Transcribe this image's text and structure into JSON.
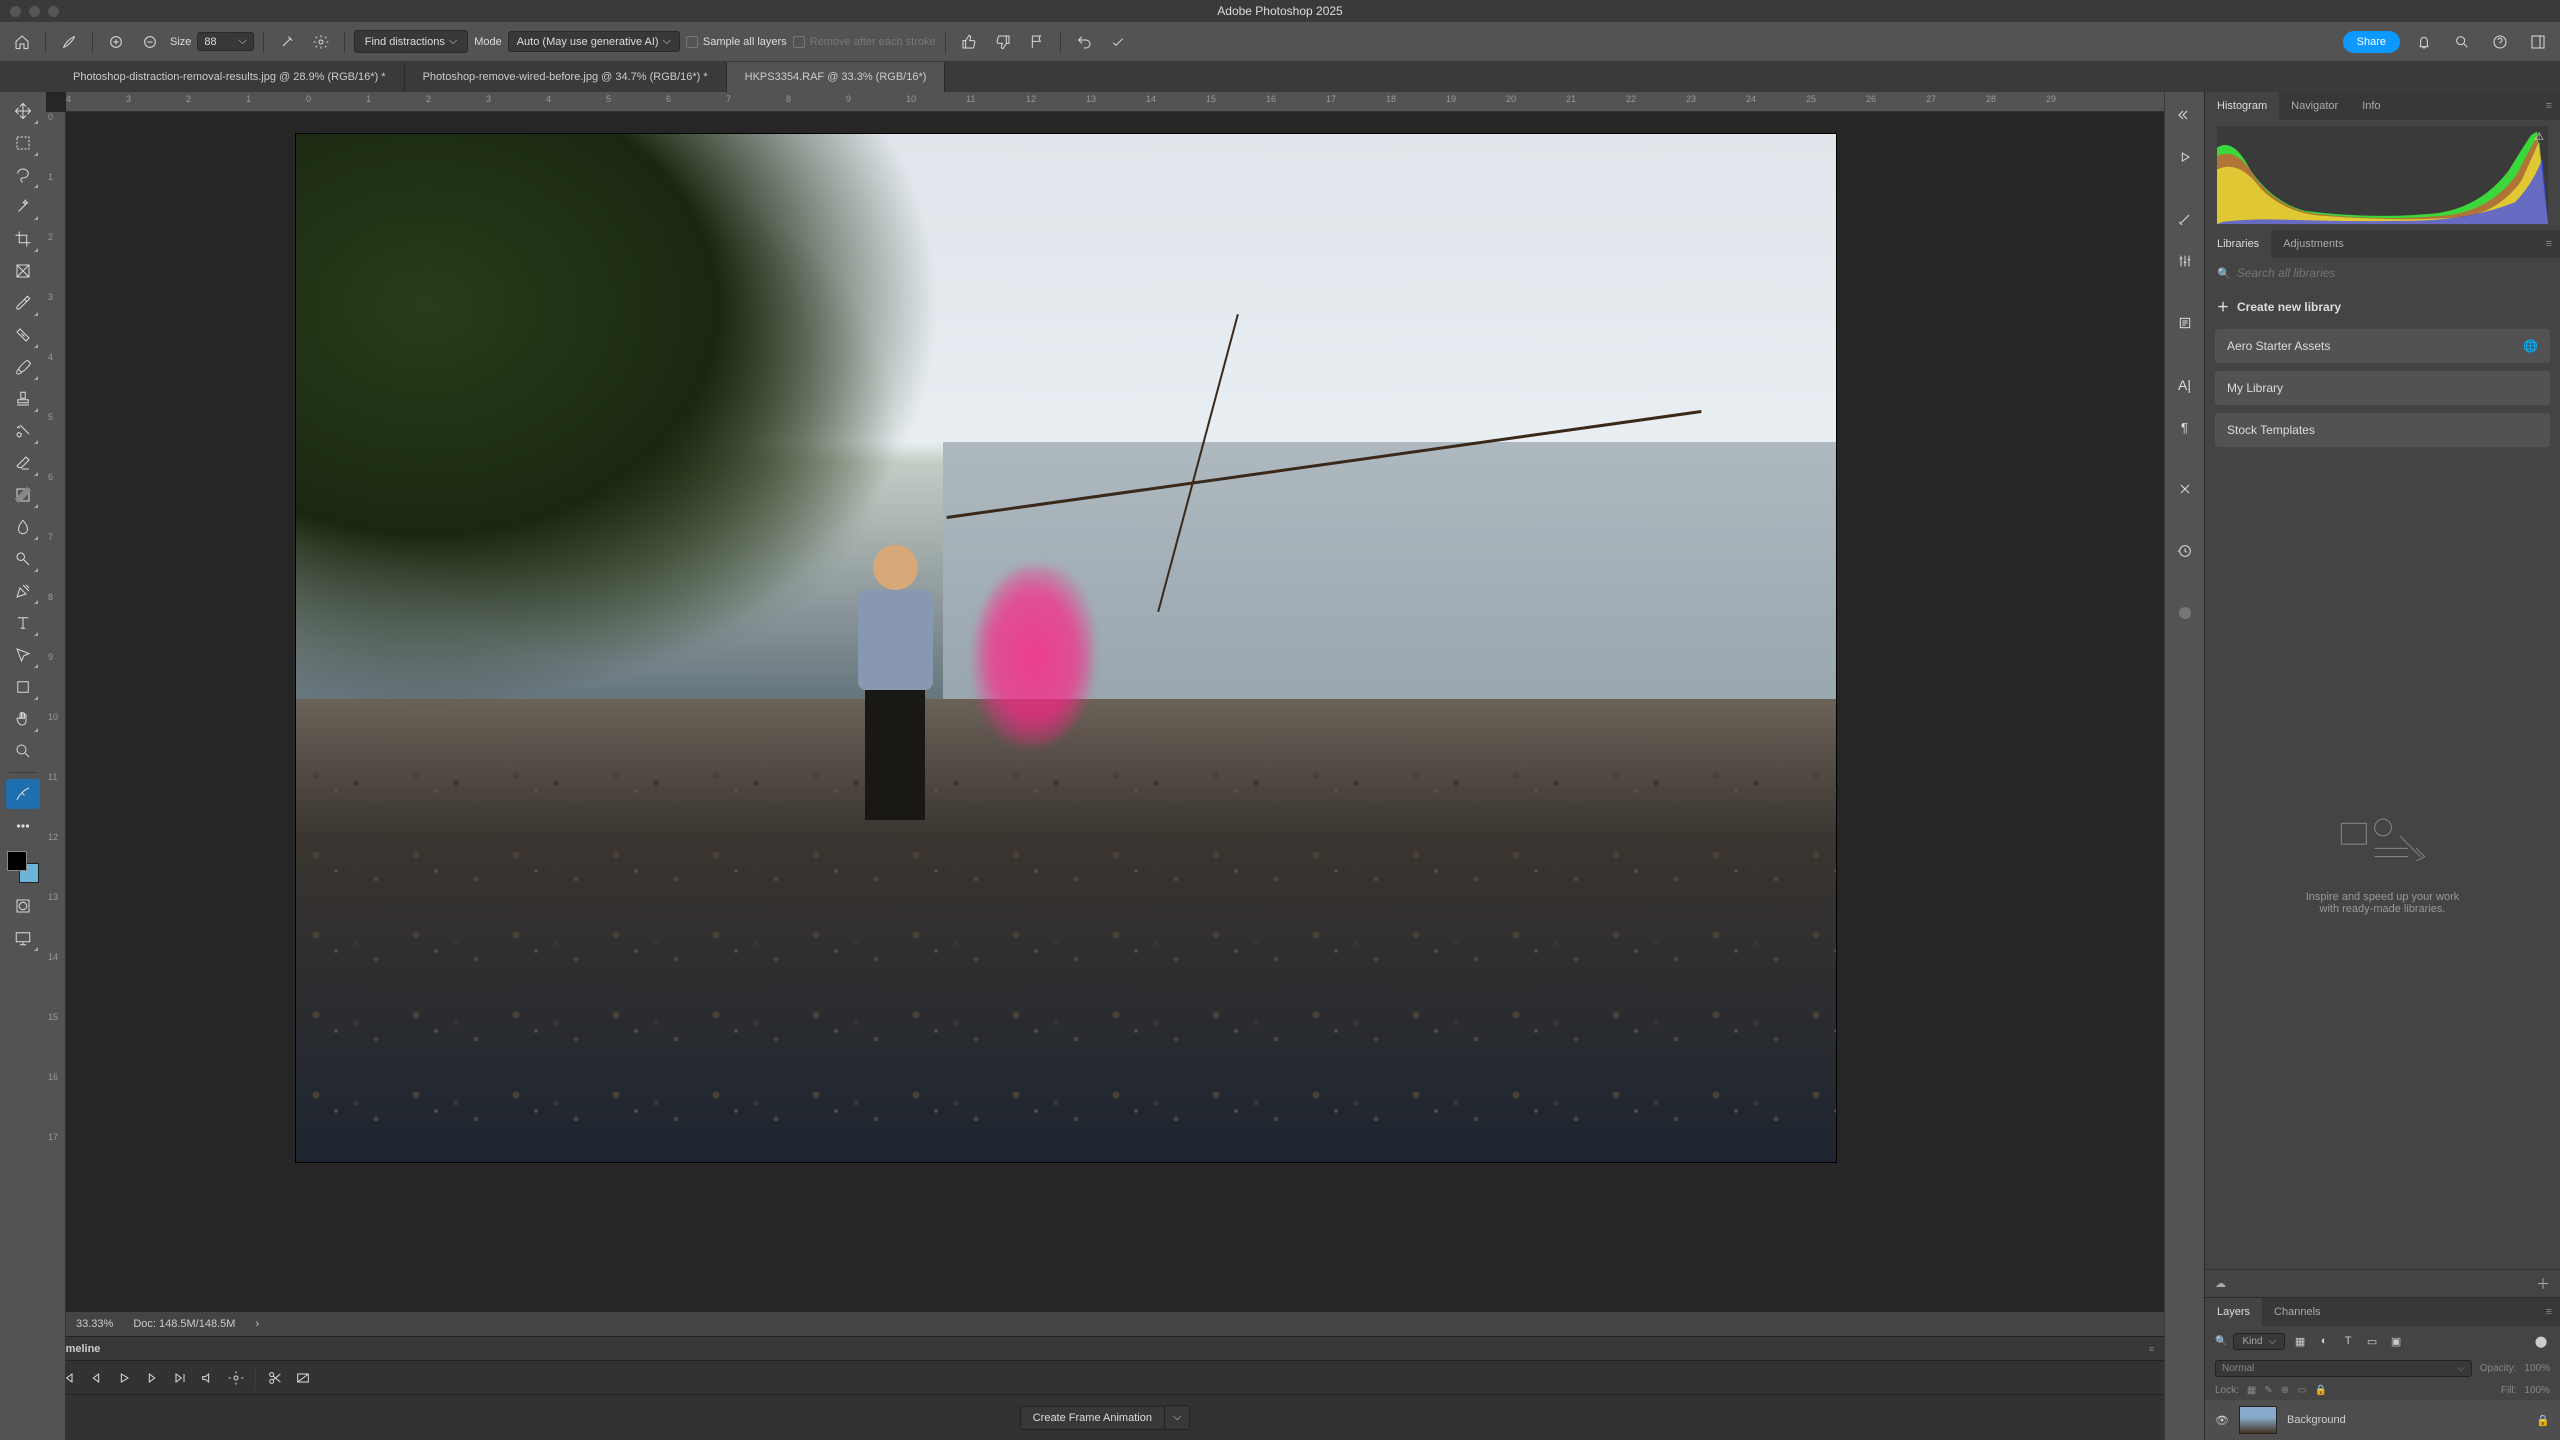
{
  "app_title": "Adobe Photoshop 2025",
  "options_bar": {
    "size_label": "Size",
    "size_value": "88",
    "find_distractions": "Find distractions",
    "mode_label": "Mode",
    "mode_value": "Auto (May use generative AI)",
    "sample_all": "Sample all layers",
    "remove_after": "Remove after each stroke",
    "share": "Share"
  },
  "tabs": [
    "Photoshop-distraction-removal-results.jpg @ 28.9% (RGB/16*) *",
    "Photoshop-remove-wired-before.jpg @ 34.7% (RGB/16*) *",
    "HKPS3354.RAF @ 33.3% (RGB/16*)"
  ],
  "ruler_h": [
    "4",
    "3",
    "2",
    "1",
    "0",
    "1",
    "2",
    "3",
    "4",
    "5",
    "6",
    "7",
    "8",
    "9",
    "10",
    "11",
    "12",
    "13",
    "14",
    "15",
    "16",
    "17",
    "18",
    "19",
    "20",
    "21",
    "22",
    "23",
    "24",
    "25",
    "26",
    "27",
    "28",
    "29"
  ],
  "ruler_v": [
    "0",
    "1",
    "2",
    "3",
    "4",
    "5",
    "6",
    "7",
    "8",
    "9",
    "10",
    "11",
    "12",
    "13",
    "14",
    "15",
    "16",
    "17"
  ],
  "status": {
    "zoom": "33.33%",
    "doc": "Doc: 148.5M/148.5M"
  },
  "timeline": {
    "title": "Timeline",
    "frame_btn": "Create Frame Animation"
  },
  "panels": {
    "top_tabs": [
      "Histogram",
      "Navigator",
      "Info"
    ],
    "mid_tabs": [
      "Libraries",
      "Adjustments"
    ],
    "search_placeholder": "Search all libraries",
    "create_library": "Create new library",
    "lib_items": [
      "Aero Starter Assets",
      "My Library",
      "Stock Templates"
    ],
    "inspire1": "Inspire and speed up your work",
    "inspire2": "with ready-made libraries.",
    "layer_tabs": [
      "Layers",
      "Channels"
    ],
    "kind": "Kind",
    "blend": "Normal",
    "opacity_label": "Opacity:",
    "opacity_val": "100%",
    "lock_label": "Lock:",
    "fill_label": "Fill:",
    "fill_val": "100%",
    "layer_name": "Background"
  }
}
